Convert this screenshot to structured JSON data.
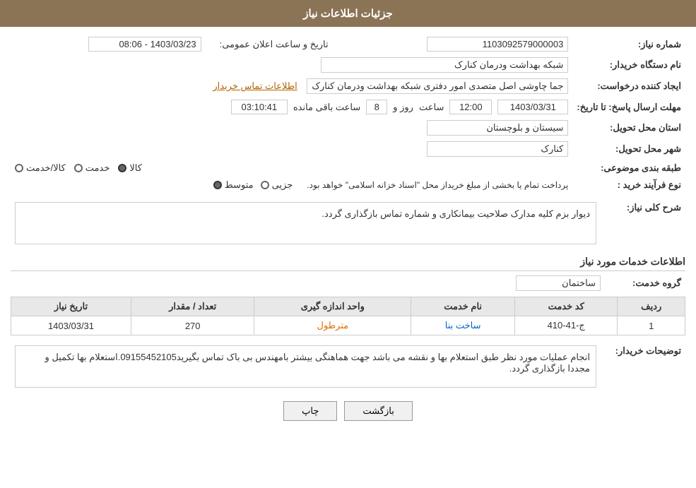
{
  "page": {
    "title": "جزئیات اطلاعات نیاز",
    "header_bg": "#8b7355"
  },
  "fields": {
    "need_number_label": "شماره نیاز:",
    "need_number_value": "1103092579000003",
    "buyer_org_label": "نام دستگاه خریدار:",
    "buyer_org_value": "شبکه بهداشت ودرمان کنارک",
    "creator_label": "ایجاد کننده درخواست:",
    "creator_value": "جما چاوشی اصل متصدی امور دفتری شبکه بهداشت ودرمان کنارک",
    "contact_link": "اطلاعات تماس خریدار",
    "deadline_label": "مهلت ارسال پاسخ: تا تاریخ:",
    "deadline_date": "1403/03/31",
    "deadline_time_label": "ساعت",
    "deadline_time": "12:00",
    "deadline_days_label": "روز و",
    "deadline_days": "8",
    "deadline_remaining_label": "ساعت باقی مانده",
    "deadline_remaining": "03:10:41",
    "province_label": "استان محل تحویل:",
    "province_value": "سیستان و بلوچستان",
    "city_label": "شهر محل تحویل:",
    "city_value": "کنارک",
    "category_label": "طبقه بندی موضوعی:",
    "category_options": [
      "کالا",
      "خدمت",
      "کالا/خدمت"
    ],
    "category_selected": "کالا",
    "purchase_type_label": "نوع فرآیند خرید :",
    "purchase_options": [
      "جزیی",
      "متوسط"
    ],
    "purchase_selected": "متوسط",
    "purchase_note": "پرداخت تمام یا بخشی از مبلغ خریداز محل \"اسناد خزانه اسلامی\" خواهد بود.",
    "announce_label": "تاریخ و ساعت اعلان عمومی:",
    "announce_value": "1403/03/23 - 08:06",
    "need_desc_label": "شرح کلی نیاز:",
    "need_desc_value": "دیوار بزم کلیه مدارک صلاحیت بیمانکاری و شماره تماس بازگذاری گردد.",
    "services_section_label": "اطلاعات خدمات مورد نیاز",
    "service_group_label": "گروه خدمت:",
    "service_group_value": "ساختمان",
    "table_headers": [
      "ردیف",
      "کد خدمت",
      "نام خدمت",
      "واحد اندازه گیری",
      "تعداد / مقدار",
      "تاریخ نیاز"
    ],
    "table_rows": [
      {
        "row": "1",
        "code": "ج-41-410",
        "name": "ساخت بنا",
        "unit": "مترطول",
        "quantity": "270",
        "date": "1403/03/31"
      }
    ],
    "buyer_note_label": "توضیحات خریدار:",
    "buyer_note_value": "انجام عملیات مورد نظر طبق استعلام بها و نقشه می باشد جهت هماهنگی بیشتر بامهندس بی باک تماس بگیرید09155452105.استعلام بها تکمیل و مجددا بازگذاری گردد.",
    "btn_back": "بازگشت",
    "btn_print": "چاپ"
  }
}
